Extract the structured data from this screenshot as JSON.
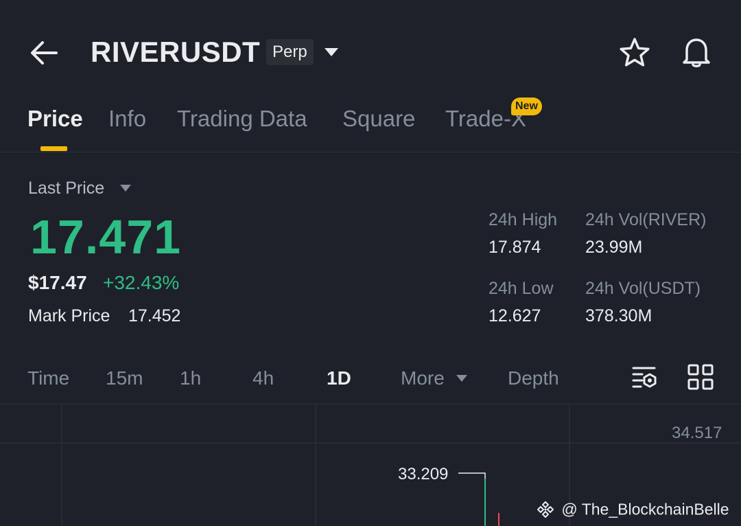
{
  "header": {
    "symbol": "RIVERUSDT",
    "contract_type": "Perp",
    "icons": [
      "back-arrow-icon",
      "chevron-down-icon",
      "star-icon",
      "bell-icon"
    ]
  },
  "tabs": [
    {
      "label": "Price",
      "active": true
    },
    {
      "label": "Info",
      "active": false
    },
    {
      "label": "Trading Data",
      "active": false
    },
    {
      "label": "Square",
      "active": false
    },
    {
      "label": "Trade-X",
      "active": false,
      "badge": "New"
    }
  ],
  "price": {
    "label": "Last Price",
    "value": "17.471",
    "usd_value": "$17.47",
    "change": "+32.43%",
    "mark_label": "Mark Price",
    "mark_value": "17.452"
  },
  "stats": {
    "high_label": "24h High",
    "high_value": "17.874",
    "low_label": "24h Low",
    "low_value": "12.627",
    "vol_base_label": "24h Vol(RIVER)",
    "vol_base_value": "23.99M",
    "vol_quote_label": "24h Vol(USDT)",
    "vol_quote_value": "378.30M"
  },
  "intervals": {
    "time": "Time",
    "m15": "15m",
    "h1": "1h",
    "h4": "4h",
    "d1": "1D",
    "more": "More",
    "depth": "Depth",
    "selected": "1D"
  },
  "chart": {
    "axis_max": "34.517",
    "high_marker": "33.209"
  },
  "watermark": {
    "text": "@ The_BlockchainBelle"
  },
  "colors": {
    "background": "#1e2129",
    "up": "#2ebd85",
    "down": "#f6465d",
    "accent": "#f0b90b",
    "text_primary": "#eaecef",
    "text_secondary": "#848e9c"
  }
}
